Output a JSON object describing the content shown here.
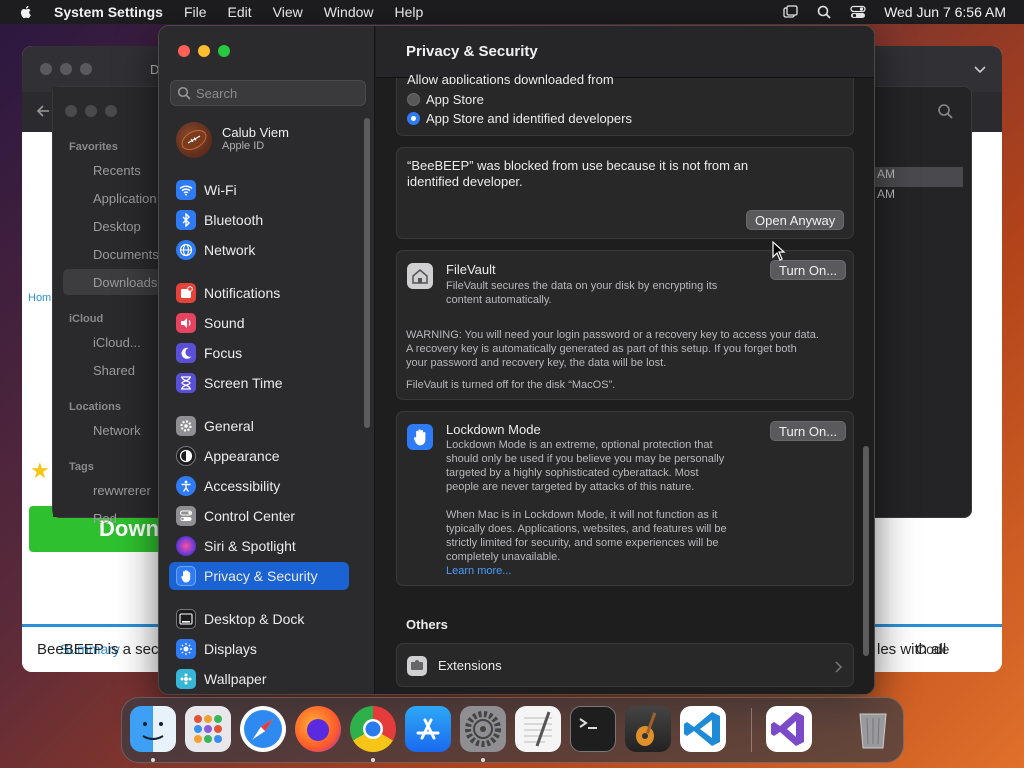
{
  "menubar": {
    "app_name": "System Settings",
    "items": [
      "File",
      "Edit",
      "View",
      "Window",
      "Help"
    ],
    "clock": "Wed Jun 7  6:56 AM",
    "icons": [
      "apple-icon",
      "window-icon",
      "spotlight-icon",
      "control-center-icon"
    ]
  },
  "background": {
    "browser_tab_summary": "Summary",
    "browser_tab_code": "Code",
    "download_label": "Down",
    "home_link": "Hom",
    "page_text_left": "BeeBEEP is a secu",
    "page_text_right": "les with all",
    "finder_tab_title": "D",
    "finder": {
      "favorites_heading": "Favorites",
      "favorites": [
        "Recents",
        "Application",
        "Desktop",
        "Documents",
        "Downloads"
      ],
      "icloud_heading": "iCloud",
      "icloud": [
        "iCloud...",
        "Shared"
      ],
      "locations_heading": "Locations",
      "locations": [
        "Network"
      ],
      "tags_heading": "Tags",
      "tags": [
        "rewwrerer",
        "Red"
      ],
      "right_rows": [
        "AM",
        "AM"
      ]
    }
  },
  "settings": {
    "search_placeholder": "Search",
    "account": {
      "name": "Calub Viem",
      "subtitle": "Apple ID"
    },
    "sidebar": [
      {
        "label": "Wi-Fi",
        "icon": "wifi-icon",
        "color": "#2f7bf5"
      },
      {
        "label": "Bluetooth",
        "icon": "bluetooth-icon",
        "color": "#2f7bf5"
      },
      {
        "label": "Network",
        "icon": "network-icon",
        "color": "#2f7bf5"
      },
      {
        "label": "Notifications",
        "icon": "notifications-icon",
        "color": "#e5433a"
      },
      {
        "label": "Sound",
        "icon": "sound-icon",
        "color": "#e5435f"
      },
      {
        "label": "Focus",
        "icon": "focus-icon",
        "color": "#5a50d8"
      },
      {
        "label": "Screen Time",
        "icon": "screen-time-icon",
        "color": "#5a50d8"
      },
      {
        "label": "General",
        "icon": "general-icon",
        "color": "#8e8e93"
      },
      {
        "label": "Appearance",
        "icon": "appearance-icon",
        "color": "#1c1c1e"
      },
      {
        "label": "Accessibility",
        "icon": "accessibility-icon",
        "color": "#2f7bf5"
      },
      {
        "label": "Control Center",
        "icon": "control-center-icon",
        "color": "#8e8e93"
      },
      {
        "label": "Siri & Spotlight",
        "icon": "siri-icon",
        "color": "#6a3bd8"
      },
      {
        "label": "Privacy & Security",
        "icon": "privacy-icon",
        "color": "#2f7bf5"
      },
      {
        "label": "Desktop & Dock",
        "icon": "desktop-dock-icon",
        "color": "#1c1c1e"
      },
      {
        "label": "Displays",
        "icon": "displays-icon",
        "color": "#2f7bf5"
      },
      {
        "label": "Wallpaper",
        "icon": "wallpaper-icon",
        "color": "#38b6d8"
      }
    ],
    "selected_item": "Privacy & Security",
    "content": {
      "title": "Privacy & Security",
      "allow_apps_heading": "Allow applications downloaded from",
      "option_app_store": "App Store",
      "option_identified": "App Store and identified developers",
      "selected_option": "App Store and identified developers",
      "blocked_message_line1": "“BeeBEEP” was blocked from use because it is not from an",
      "blocked_message_line2": "identified developer.",
      "open_anyway_button": "Open Anyway",
      "filevault": {
        "title": "FileVault",
        "desc_line1": "FileVault secures the data on your disk by encrypting its",
        "desc_line2": "content automatically.",
        "button": "Turn On...",
        "warning_line1": "WARNING: You will need your login password or a recovery key to access your data.",
        "warning_line2": "A recovery key is automatically generated as part of this setup. If you forget both",
        "warning_line3": "your password and recovery key, the data will be lost.",
        "status": "FileVault is turned off for the disk “MacOS”."
      },
      "lockdown": {
        "title": "Lockdown Mode",
        "button": "Turn On...",
        "desc_line1": "Lockdown Mode is an extreme, optional protection that",
        "desc_line2": "should only be used if you believe you may be personally",
        "desc_line3": "targeted by a highly sophisticated cyberattack. Most",
        "desc_line4": "people are never targeted by attacks of this nature.",
        "desc2_line1": "When Mac is in Lockdown Mode, it will not function as it",
        "desc2_line2": "typically does. Applications, websites, and features will be",
        "desc2_line3": "strictly limited for security, and some experiences will be",
        "desc2_line4": "completely unavailable.",
        "learn_more": "Learn more..."
      },
      "others_heading": "Others",
      "extensions_label": "Extensions"
    }
  },
  "dock": {
    "apps": [
      "Finder",
      "Launchpad",
      "Safari",
      "Firefox",
      "Chrome",
      "App Store",
      "System Settings",
      "TextEdit",
      "Terminal",
      "GarageBand",
      "Visual Studio Code",
      "Visual Studio",
      "Trash"
    ]
  }
}
